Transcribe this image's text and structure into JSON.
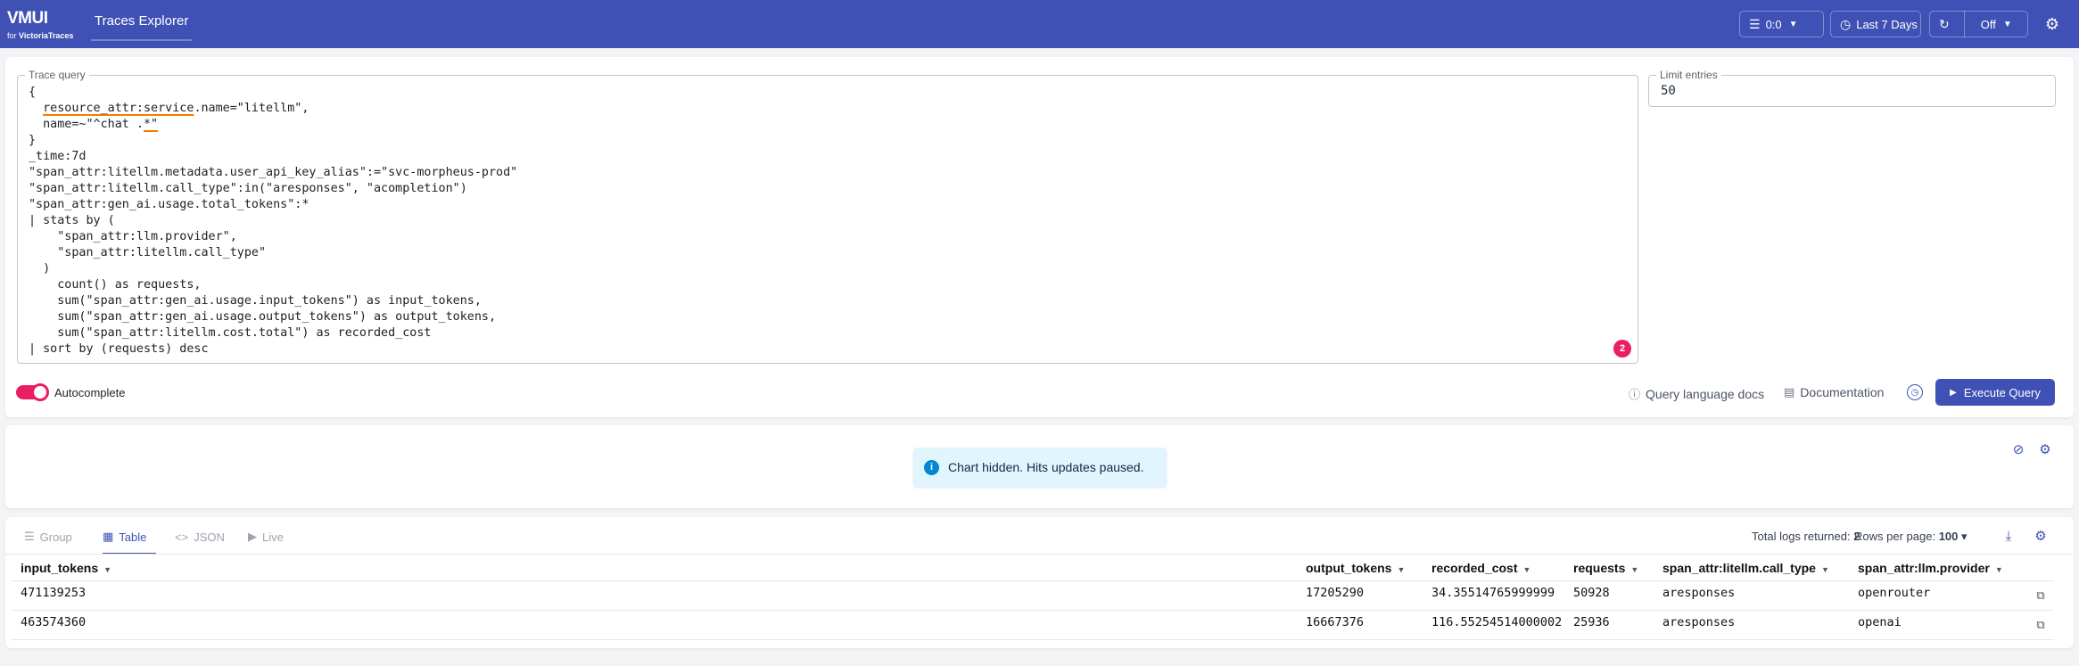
{
  "header": {
    "logo_main": "VMUI",
    "logo_for": "for",
    "logo_brand": "VictoriaTraces",
    "nav_tab": "Traces Explorer",
    "columns_label": "0:0",
    "time_label": "Last 7 Days",
    "refresh_label": "Off",
    "accent": "#3f51b5"
  },
  "query": {
    "legend": "Trace query",
    "limit_legend": "Limit entries",
    "limit_value": "50",
    "error_count": "2",
    "autocomplete_label": "Autocomplete",
    "autocomplete_on": true,
    "links": {
      "query_docs": "Query language docs",
      "documentation": "Documentation"
    },
    "execute_label": "Execute Query"
  },
  "chart": {
    "notice": "Chart hidden. Hits updates paused."
  },
  "results": {
    "tabs": [
      {
        "label": "Group",
        "icon": "list-icon"
      },
      {
        "label": "Table",
        "icon": "table-icon",
        "active": true
      },
      {
        "label": "JSON",
        "icon": "code-icon"
      },
      {
        "label": "Live",
        "icon": "play-icon"
      }
    ],
    "total_label": "Total logs returned:",
    "total_value": "2",
    "rows_per_page_label": "Rows per page:",
    "rows_per_page_value": "100",
    "columns": [
      "input_tokens",
      "output_tokens",
      "recorded_cost",
      "requests",
      "span_attr:litellm.call_type",
      "span_attr:llm.provider"
    ],
    "rows": [
      [
        "471139253",
        "17205290",
        "34.35514765999999",
        "50928",
        "aresponses",
        "openrouter"
      ],
      [
        "463574360",
        "16667376",
        "116.55254514000002",
        "25936",
        "aresponses",
        "openai"
      ]
    ]
  },
  "colors": {
    "error_badge": "#e91e63",
    "toggle": "#e91e63",
    "notice_bg": "#e1f5fe"
  }
}
